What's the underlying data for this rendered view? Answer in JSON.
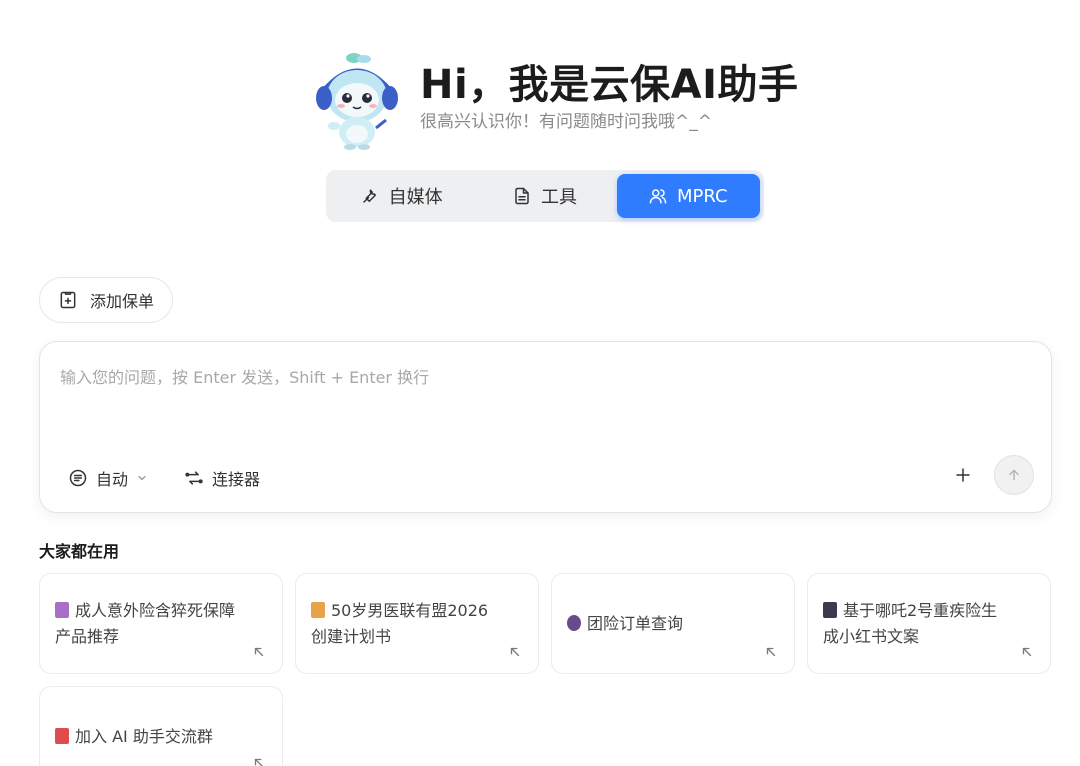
{
  "hero": {
    "title": "Hi，我是云保AI助手",
    "subtitle": "很高兴认识你！有问题随时问我哦^_^"
  },
  "tabs": [
    {
      "label": "自媒体",
      "icon": "wrench-icon",
      "active": false
    },
    {
      "label": "工具",
      "icon": "document-icon",
      "active": false
    },
    {
      "label": "MPRC",
      "icon": "users-icon",
      "active": true
    }
  ],
  "add_policy": {
    "label": "添加保单",
    "icon": "clipboard-add-icon"
  },
  "composer": {
    "placeholder": "输入您的问题，按 Enter 发送，Shift + Enter 换行",
    "mode_label": "自动",
    "connector_label": "连接器"
  },
  "popular": {
    "title": "大家都在用",
    "items": [
      {
        "label": "成人意外险含猝死保障产品推荐",
        "emoji_color": "#a86fc9"
      },
      {
        "label": "50岁男医联有盟2026创建计划书",
        "emoji_color": "#e8a24a"
      },
      {
        "label": "团险订单查询",
        "emoji_color": "#6a4a8c"
      },
      {
        "label": "基于哪吒2号重疾险生成小红书文案",
        "emoji_color": "#3b3b4f"
      },
      {
        "label": "加入 AI 助手交流群",
        "emoji_color": "#e24b4b"
      }
    ]
  },
  "colors": {
    "accent": "#2f7cff"
  }
}
